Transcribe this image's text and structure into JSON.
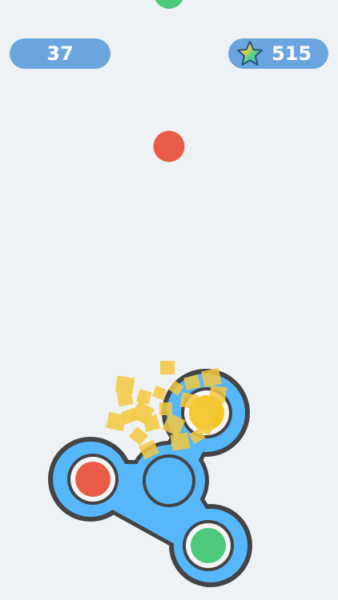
{
  "hud": {
    "score": "37",
    "coins": "515",
    "coin_icon": "rainbow-star-icon"
  },
  "game": {
    "spinner": {
      "frame_color": "#444444",
      "body_color": "#57b7fb",
      "bearing_colors": [
        "#e85c47",
        "#f5c81e",
        "#4cc97a"
      ]
    },
    "falling_balls": [
      {
        "color": "#4cc97a"
      },
      {
        "color": "#e85c47"
      }
    ],
    "particle_color": "#f3c93e"
  },
  "colors": {
    "background": "#eff2f4",
    "hud_pill": "#6aa5e0",
    "hud_text": "#ffffff"
  }
}
